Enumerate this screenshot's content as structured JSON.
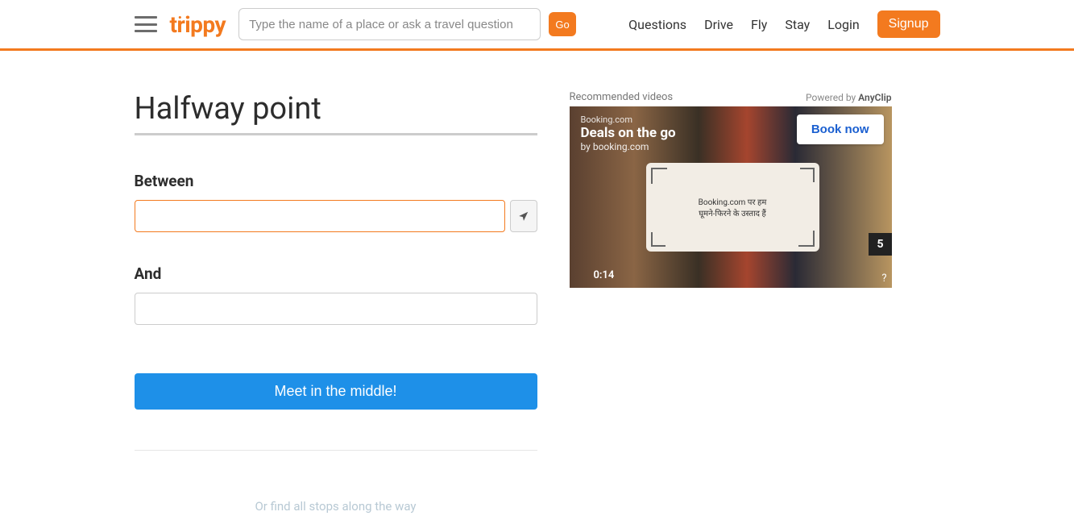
{
  "header": {
    "logo": "trippy",
    "search_placeholder": "Type the name of a place or ask a travel question",
    "go_label": "Go",
    "nav": {
      "questions": "Questions",
      "drive": "Drive",
      "fly": "Fly",
      "stay": "Stay",
      "login": "Login",
      "signup": "Signup"
    }
  },
  "main": {
    "title": "Halfway point",
    "between_label": "Between",
    "and_label": "And",
    "between_value": "",
    "and_value": "",
    "submit_label": "Meet in the middle!",
    "alt_link": "Or find all stops along the way"
  },
  "sidebar": {
    "recommended_label": "Recommended videos",
    "powered_prefix": "Powered by ",
    "powered_brand": "AnyClip",
    "video": {
      "brand": "Booking.com",
      "title": "Deals on the go",
      "subtitle": "by booking.com",
      "cta": "Book now",
      "card_line1": "Booking.com पर हम",
      "card_line2": "घूमने-फिरने के उस्ताद हैं",
      "time": "0:14",
      "countdown": "5",
      "help": "?"
    }
  }
}
